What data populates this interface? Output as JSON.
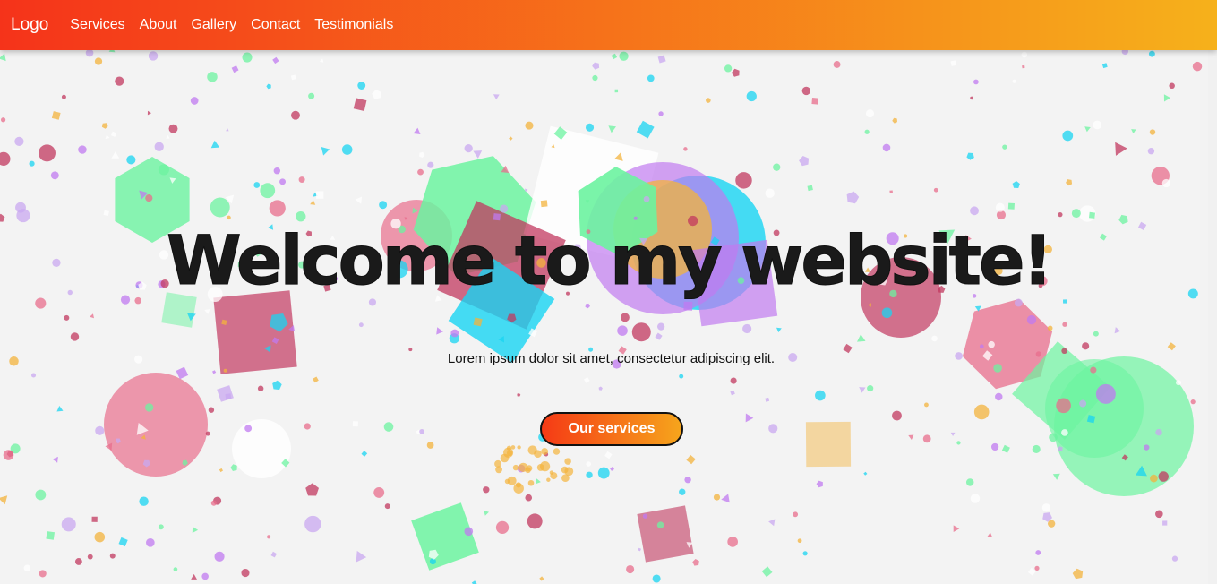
{
  "navbar": {
    "logo": "Logo",
    "links": [
      "Services",
      "About",
      "Gallery",
      "Contact",
      "Testimonials"
    ],
    "gradient_start": "#f5331a",
    "gradient_end": "#f6b11b"
  },
  "hero": {
    "title": "Welcome to my website!",
    "text": "Lorem ipsum dolor sit amet, consectetur adipiscing elit.",
    "cta_label": "Our services",
    "cta_gradient_start": "#f53a15",
    "cta_gradient_end": "#f6a51c"
  },
  "palette": {
    "background": "#f3f3f3",
    "green": "#6cf3a0",
    "pink": "#e86d8c",
    "crimson": "#c2385f",
    "cyan": "#18d4f2",
    "purple": "#c07af0",
    "lavender": "#c9a8f0",
    "orange": "#f3b33c",
    "white": "#ffffff"
  }
}
